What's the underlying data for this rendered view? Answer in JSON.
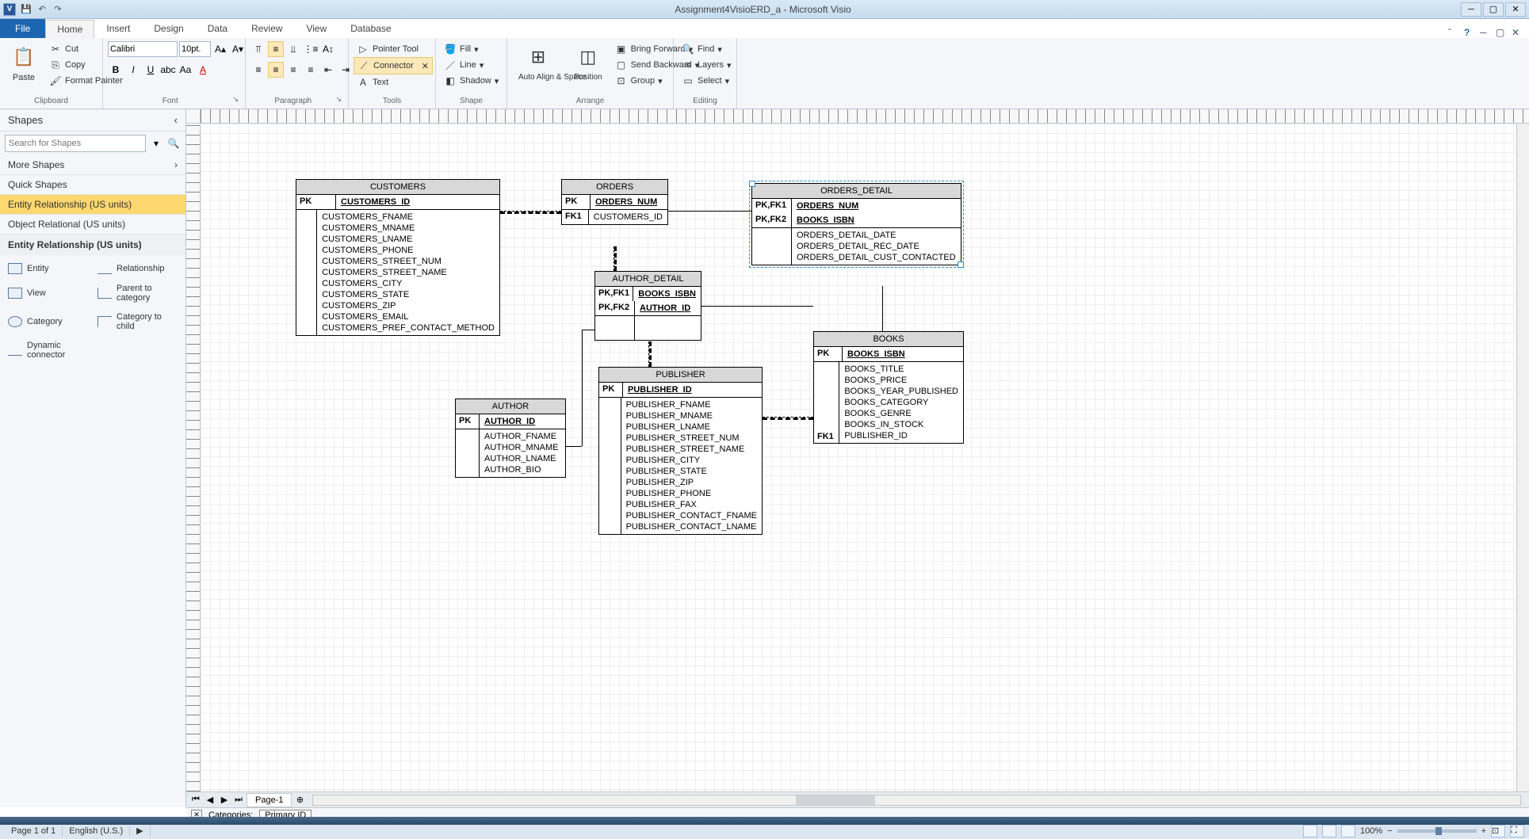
{
  "window": {
    "title": "Assignment4VisioERD_a  -  Microsoft Visio",
    "app_letter": "V"
  },
  "qat": {
    "save": "💾",
    "undo": "↶",
    "redo": "↷"
  },
  "tabs": {
    "file": "File",
    "home": "Home",
    "insert": "Insert",
    "design": "Design",
    "data": "Data",
    "review": "Review",
    "view": "View",
    "database": "Database"
  },
  "ribbon": {
    "clipboard": {
      "label": "Clipboard",
      "paste": "Paste",
      "cut": "Cut",
      "copy": "Copy",
      "format_painter": "Format Painter"
    },
    "font": {
      "label": "Font",
      "family": "Calibri",
      "size": "10pt."
    },
    "paragraph": {
      "label": "Paragraph"
    },
    "tools": {
      "label": "Tools",
      "pointer": "Pointer Tool",
      "connector": "Connector",
      "text": "Text"
    },
    "shape": {
      "label": "Shape",
      "fill": "Fill",
      "line": "Line",
      "shadow": "Shadow"
    },
    "arrange": {
      "label": "Arrange",
      "autoalign": "Auto Align & Space",
      "position": "Position",
      "bring_forward": "Bring Forward",
      "send_backward": "Send Backward",
      "group": "Group"
    },
    "editing": {
      "label": "Editing",
      "find": "Find",
      "layers": "Layers",
      "select": "Select"
    }
  },
  "shapes_panel": {
    "title": "Shapes",
    "search_placeholder": "Search for Shapes",
    "more_shapes": "More Shapes",
    "quick_shapes": "Quick Shapes",
    "er_us": "Entity Relationship (US units)",
    "or_us": "Object Relational (US units)",
    "section_title": "Entity Relationship (US units)",
    "items": {
      "entity": "Entity",
      "relationship": "Relationship",
      "view": "View",
      "parent_to_cat": "Parent to category",
      "category": "Category",
      "cat_to_child": "Category to child",
      "dyn_conn": "Dynamic connector"
    }
  },
  "entities": {
    "customers": {
      "title": "CUSTOMERS",
      "pk_label": "PK",
      "pk": "CUSTOMERS_ID",
      "fields": [
        "CUSTOMERS_FNAME",
        "CUSTOMERS_MNAME",
        "CUSTOMERS_LNAME",
        "CUSTOMERS_PHONE",
        "CUSTOMERS_STREET_NUM",
        "CUSTOMERS_STREET_NAME",
        "CUSTOMERS_CITY",
        "CUSTOMERS_STATE",
        "CUSTOMERS_ZIP",
        "CUSTOMERS_EMAIL",
        "CUSTOMERS_PREF_CONTACT_METHOD"
      ]
    },
    "orders": {
      "title": "ORDERS",
      "pk_label": "PK",
      "pk": "ORDERS_NUM",
      "fk1_label": "FK1",
      "fk1": "CUSTOMERS_ID"
    },
    "orders_detail": {
      "title": "ORDERS_DETAIL",
      "pk1_label": "PK,FK1",
      "pk1": "ORDERS_NUM",
      "pk2_label": "PK,FK2",
      "pk2": "BOOKS_ISBN",
      "fields": [
        "ORDERS_DETAIL_DATE",
        "ORDERS_DETAIL_REC_DATE",
        "ORDERS_DETAIL_CUST_CONTACTED"
      ]
    },
    "author_detail": {
      "title": "AUTHOR_DETAIL",
      "pk1_label": "PK,FK1",
      "pk1": "BOOKS_ISBN",
      "pk2_label": "PK,FK2",
      "pk2": "AUTHOR_ID"
    },
    "books": {
      "title": "BOOKS",
      "pk_label": "PK",
      "pk": "BOOKS_ISBN",
      "fk1_label": "FK1",
      "fields": [
        "BOOKS_TITLE",
        "BOOKS_PRICE",
        "BOOKS_YEAR_PUBLISHED",
        "BOOKS_CATEGORY",
        "BOOKS_GENRE",
        "BOOKS_IN_STOCK",
        "PUBLISHER_ID"
      ]
    },
    "author": {
      "title": "AUTHOR",
      "pk_label": "PK",
      "pk": "AUTHOR_ID",
      "fields": [
        "AUTHOR_FNAME",
        "AUTHOR_MNAME",
        "AUTHOR_LNAME",
        "AUTHOR_BIO"
      ]
    },
    "publisher": {
      "title": "PUBLISHER",
      "pk_label": "PK",
      "pk": "PUBLISHER_ID",
      "fields": [
        "PUBLISHER_FNAME",
        "PUBLISHER_MNAME",
        "PUBLISHER_LNAME",
        "PUBLISHER_STREET_NUM",
        "PUBLISHER_STREET_NAME",
        "PUBLISHER_CITY",
        "PUBLISHER_STATE",
        "PUBLISHER_ZIP",
        "PUBLISHER_PHONE",
        "PUBLISHER_FAX",
        "PUBLISHER_CONTACT_FNAME",
        "PUBLISHER_CONTACT_LNAME"
      ]
    }
  },
  "page_tabs": {
    "page1": "Page-1"
  },
  "categories": {
    "label": "Categories:",
    "primary": "Primary ID"
  },
  "status": {
    "page": "Page 1 of 1",
    "lang": "English (U.S.)",
    "zoom": "100%"
  }
}
